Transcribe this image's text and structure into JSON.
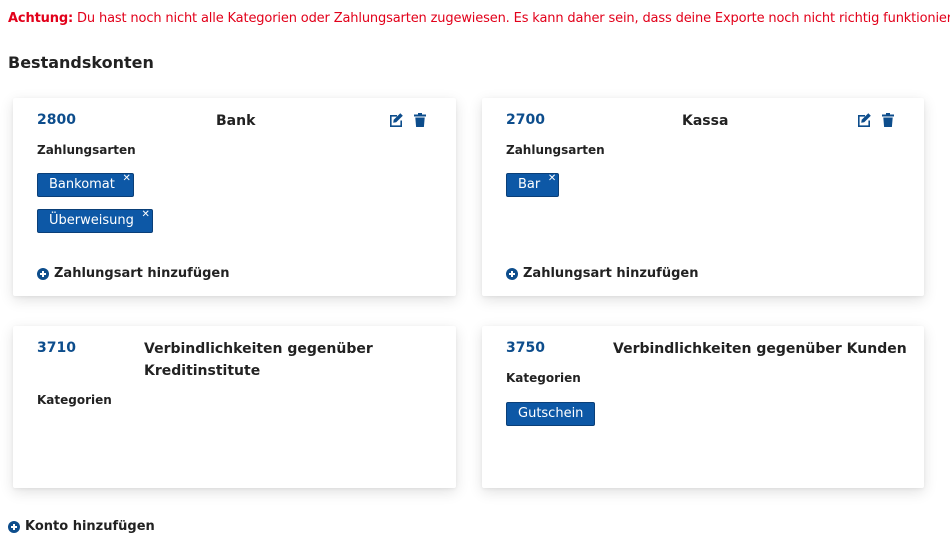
{
  "warning": {
    "prefix": "Achtung:",
    "text": " Du hast noch nicht alle Kategorien oder Zahlungsarten zugewiesen. Es kann daher sein, dass deine Exporte noch nicht richtig funktionieren."
  },
  "section_title": "Bestandskonten",
  "cards": [
    {
      "number": "2800",
      "name": "Bank",
      "sub_label": "Zahlungsarten",
      "tags": [
        "Bankomat",
        "Überweisung"
      ],
      "add_label": "Zahlungsart hinzufügen"
    },
    {
      "number": "2700",
      "name": "Kassa",
      "sub_label": "Zahlungsarten",
      "tags": [
        "Bar"
      ],
      "add_label": "Zahlungsart hinzufügen"
    },
    {
      "number": "3710",
      "name": "Verbindlichkeiten gegenüber Kreditinstitute",
      "sub_label": "Kategorien",
      "tags": []
    },
    {
      "number": "3750",
      "name": "Verbindlichkeiten gegenüber Kunden",
      "sub_label": "Kategorien",
      "tags": [
        "Gutschein"
      ]
    }
  ],
  "add_account_label": "Konto hinzufügen",
  "icons": {
    "edit": "edit-icon",
    "delete": "trash-icon",
    "remove": "close-icon",
    "add": "plus-circle-icon"
  },
  "colors": {
    "warning": "#e2001a",
    "accent": "#0d4d8c",
    "tag_bg": "#0d58a6"
  }
}
